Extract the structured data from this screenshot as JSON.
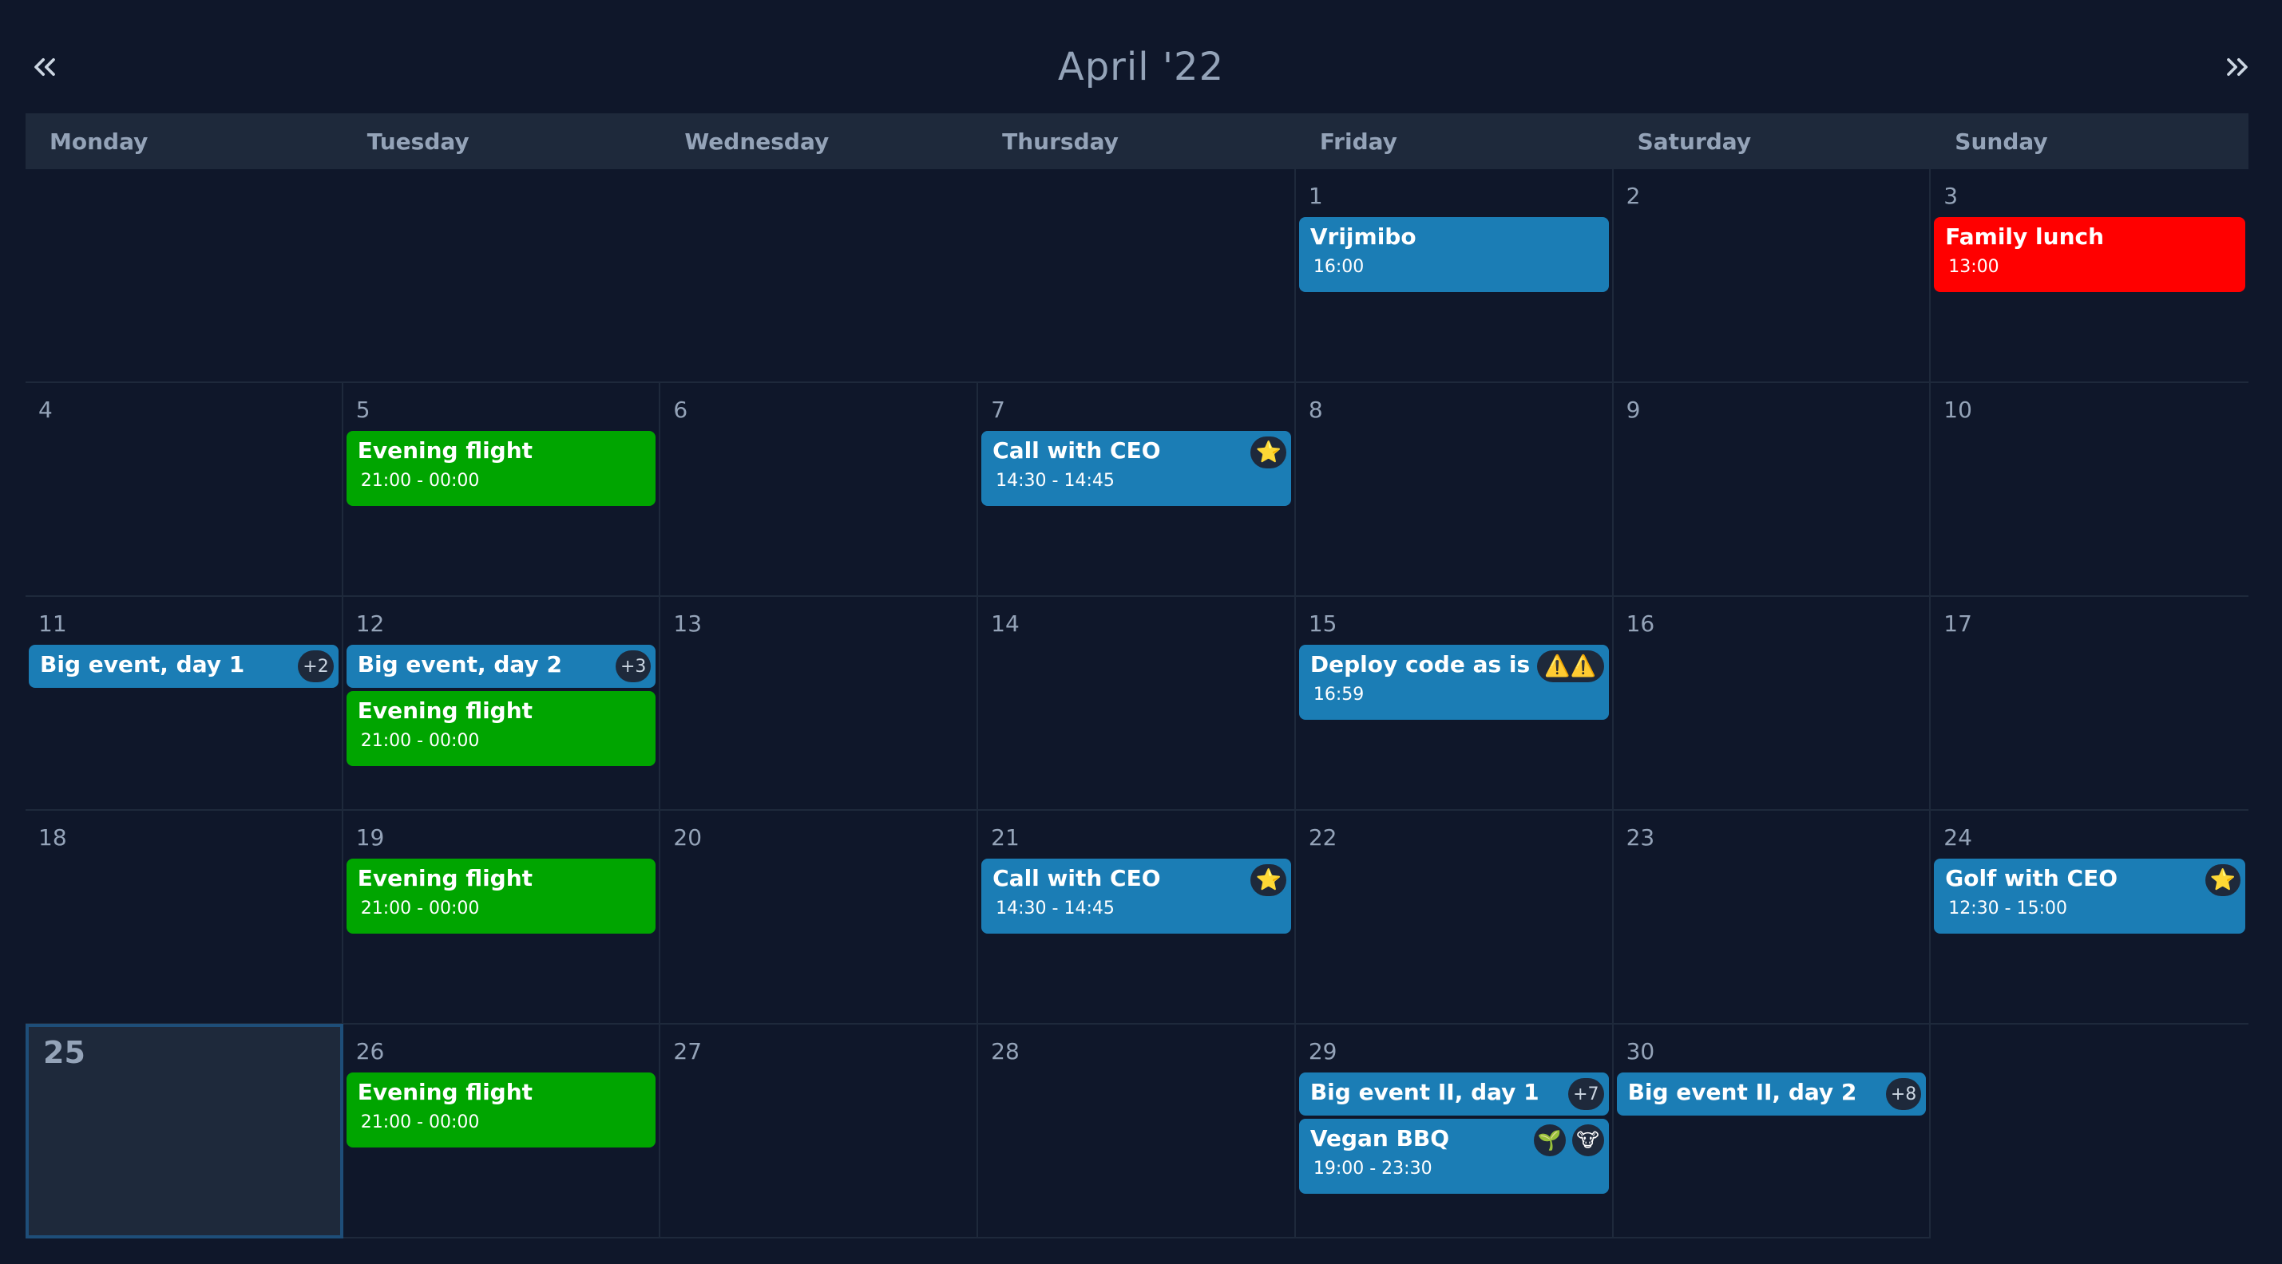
{
  "header": {
    "title": "April '22",
    "prev_icon": "double-chevron-left-icon",
    "next_icon": "double-chevron-right-icon"
  },
  "weekdays": [
    "Monday",
    "Tuesday",
    "Wednesday",
    "Thursday",
    "Friday",
    "Saturday",
    "Sunday"
  ],
  "days": {
    "d1": "1",
    "d2": "2",
    "d3": "3",
    "d4": "4",
    "d5": "5",
    "d6": "6",
    "d7": "7",
    "d8": "8",
    "d9": "9",
    "d10": "10",
    "d11": "11",
    "d12": "12",
    "d13": "13",
    "d14": "14",
    "d15": "15",
    "d16": "16",
    "d17": "17",
    "d18": "18",
    "d19": "19",
    "d20": "20",
    "d21": "21",
    "d22": "22",
    "d23": "23",
    "d24": "24",
    "d25": "25",
    "d26": "26",
    "d27": "27",
    "d28": "28",
    "d29": "29",
    "d30": "30"
  },
  "events": {
    "vrijmibo": {
      "title": "Vrijmibo",
      "time": "16:00",
      "color": "#1b7db5"
    },
    "family_lunch": {
      "title": "Family lunch",
      "time": "13:00",
      "color": "#ff0000"
    },
    "flight_5": {
      "title": "Evening flight",
      "time": "21:00 - 00:00",
      "color": "#00a500"
    },
    "ceo_7": {
      "title": "Call with CEO",
      "time": "14:30 - 14:45",
      "icon": "star-icon"
    },
    "big1": {
      "title": "Big event, day 1",
      "badge": "+2"
    },
    "big2": {
      "title": "Big event, day 2",
      "badge": "+3"
    },
    "flight_12": {
      "title": "Evening flight",
      "time": "21:00 - 00:00"
    },
    "deploy": {
      "title": "Deploy code as is",
      "time": "16:59",
      "icon": "warning-icon"
    },
    "flight_19": {
      "title": "Evening flight",
      "time": "21:00 - 00:00"
    },
    "ceo_21": {
      "title": "Call with CEO",
      "time": "14:30 - 14:45",
      "icon": "star-icon"
    },
    "golf": {
      "title": "Golf with CEO",
      "time": "12:30 - 15:00",
      "icon": "star-icon"
    },
    "flight_26": {
      "title": "Evening flight",
      "time": "21:00 - 00:00"
    },
    "big2_1": {
      "title": "Big event II, day 1",
      "badge": "+7"
    },
    "bbq": {
      "title": "Vegan BBQ",
      "time": "19:00 - 23:30",
      "icons": [
        "seedling-icon",
        "cow-icon"
      ]
    },
    "big2_2": {
      "title": "Big event II, day 2",
      "badge": "+8"
    }
  }
}
